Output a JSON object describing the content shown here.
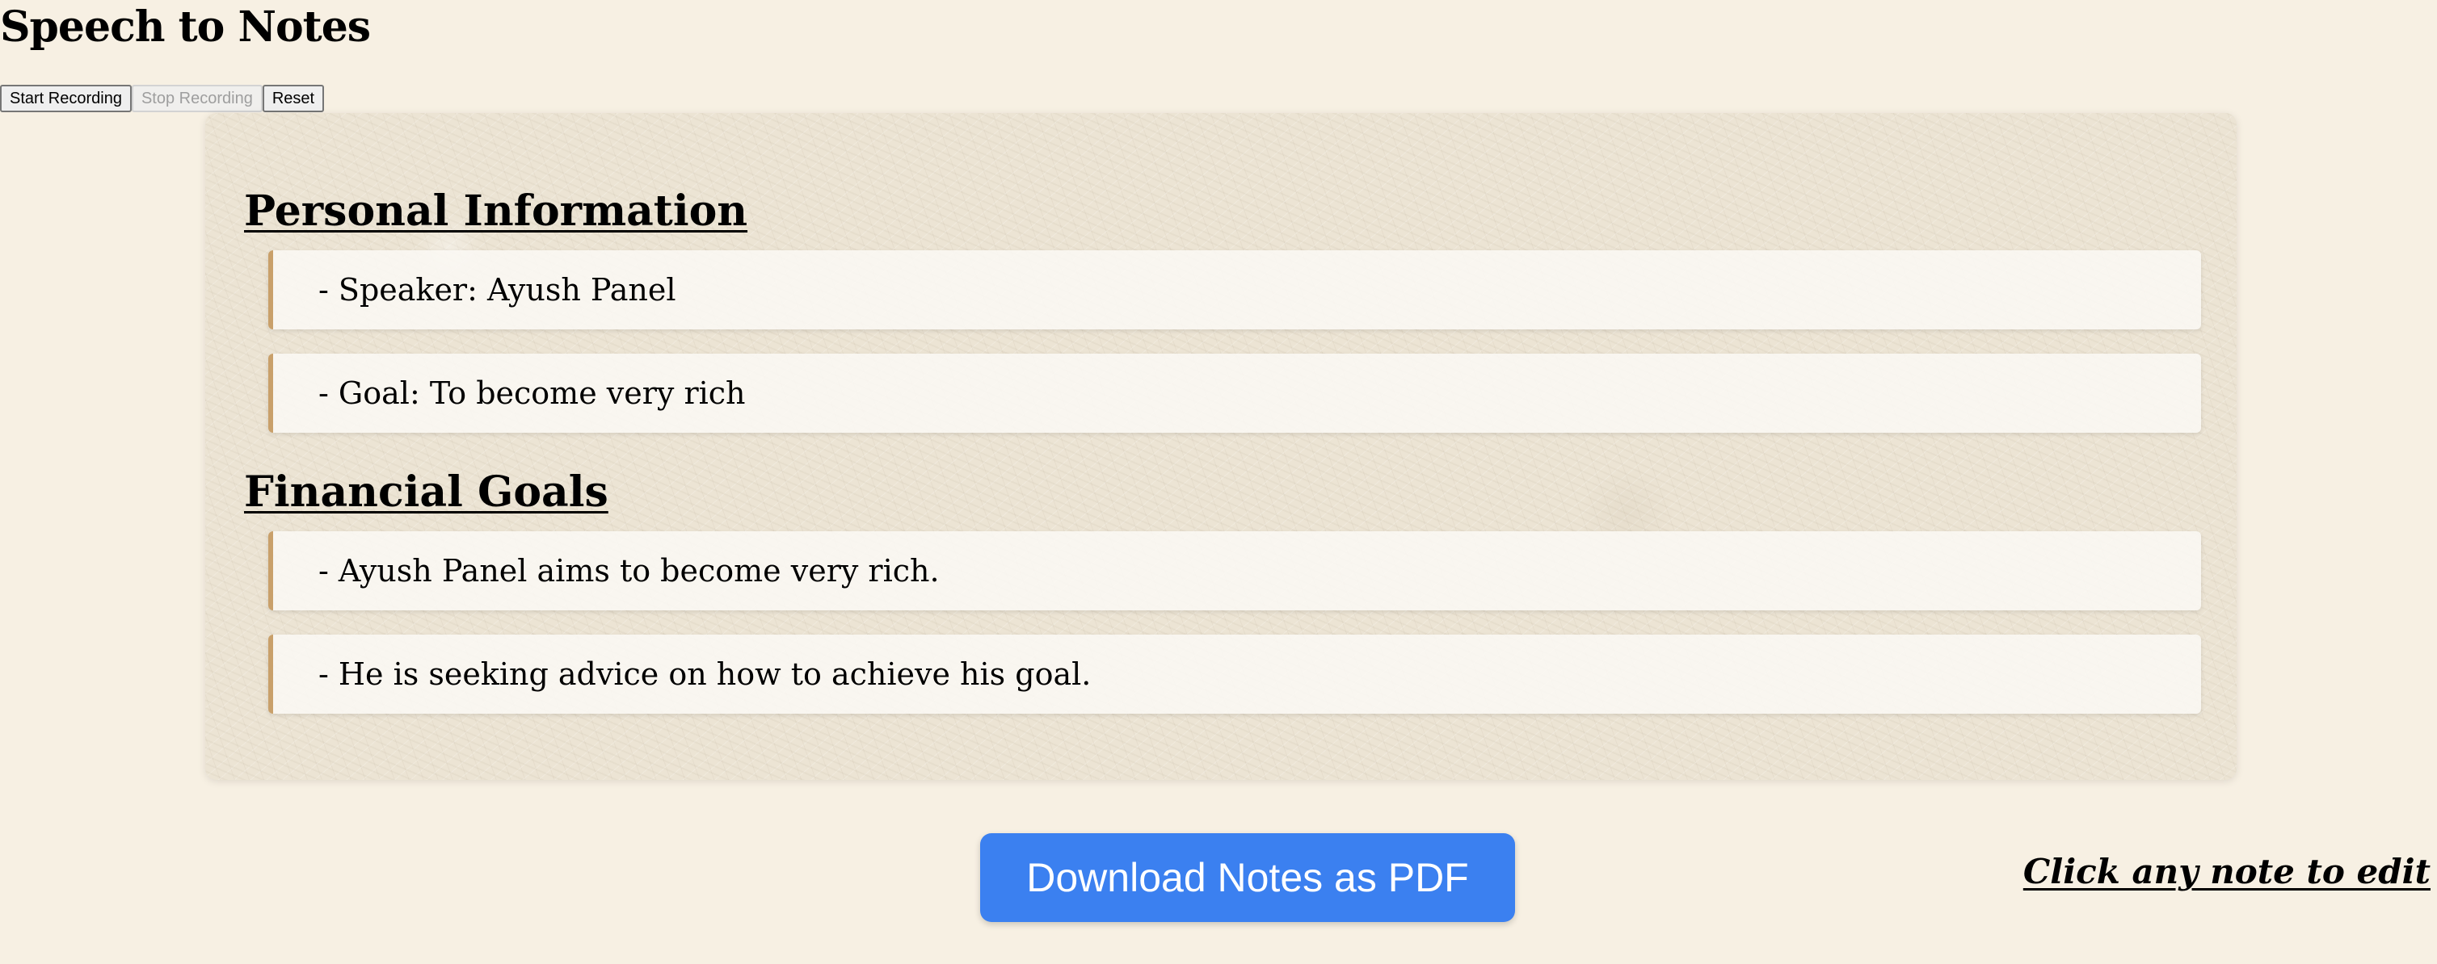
{
  "app": {
    "title": "Speech to Notes"
  },
  "controls": {
    "start_label": "Start Recording",
    "stop_label": "Stop Recording",
    "reset_label": "Reset"
  },
  "notes": {
    "sections": [
      {
        "heading": "Personal Information",
        "items": [
          "- Speaker: Ayush Panel",
          "- Goal: To become very rich"
        ]
      },
      {
        "heading": "Financial Goals",
        "items": [
          "- Ayush Panel aims to become very rich.",
          "- He is seeking advice on how to achieve his goal."
        ]
      }
    ]
  },
  "footer": {
    "download_label": "Download Notes as PDF",
    "edit_hint": "Click any note to edit"
  },
  "colors": {
    "page_background": "#f7f0e3",
    "accent_border": "#c9a06a",
    "download_button": "#3b80f0"
  }
}
